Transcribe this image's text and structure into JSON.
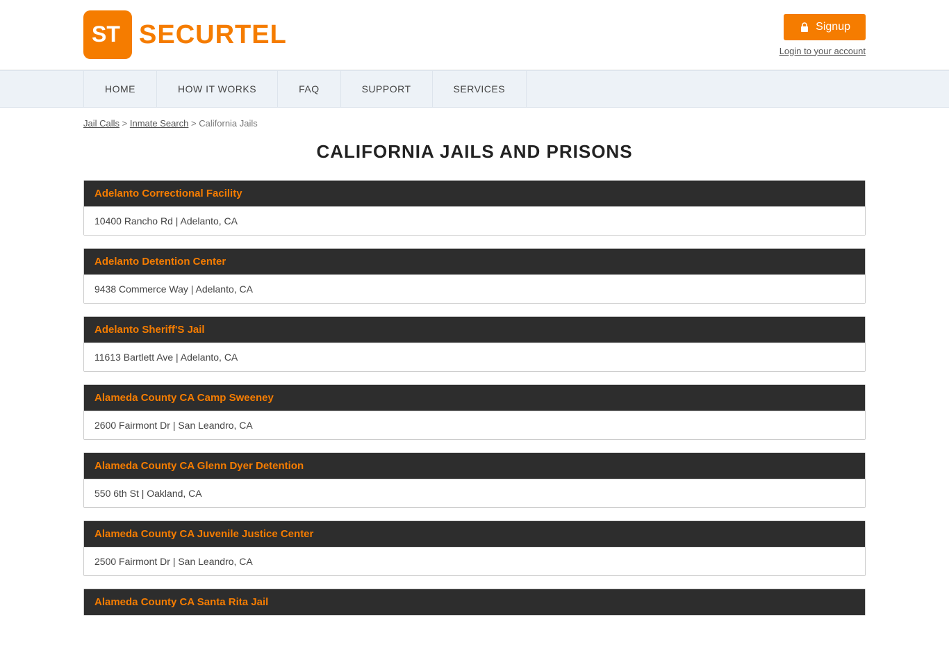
{
  "header": {
    "logo_text_part1": "SECUR",
    "logo_text_part2": "TEL",
    "signup_label": "Signup",
    "login_label": "Login to your account"
  },
  "nav": {
    "items": [
      {
        "label": "HOME"
      },
      {
        "label": "HOW IT WORKS"
      },
      {
        "label": "FAQ"
      },
      {
        "label": "SUPPORT"
      },
      {
        "label": "SERVICES"
      }
    ]
  },
  "breadcrumb": {
    "jail_calls": "Jail Calls",
    "inmate_search": "Inmate Search",
    "current": "California Jails"
  },
  "page": {
    "title": "CALIFORNIA JAILS AND PRISONS"
  },
  "facilities": [
    {
      "name": "Adelanto Correctional Facility",
      "address": "10400 Rancho Rd | Adelanto, CA"
    },
    {
      "name": "Adelanto Detention Center",
      "address": "9438 Commerce Way | Adelanto, CA"
    },
    {
      "name": "Adelanto Sheriff'S Jail",
      "address": "11613 Bartlett Ave | Adelanto, CA"
    },
    {
      "name": "Alameda County CA Camp Sweeney",
      "address": "2600 Fairmont Dr | San Leandro, CA"
    },
    {
      "name": "Alameda County CA Glenn Dyer Detention",
      "address": "550 6th St | Oakland, CA"
    },
    {
      "name": "Alameda County CA Juvenile Justice Center",
      "address": "2500 Fairmont Dr | San Leandro, CA"
    },
    {
      "name": "Alameda County CA Santa Rita Jail",
      "address": ""
    }
  ]
}
